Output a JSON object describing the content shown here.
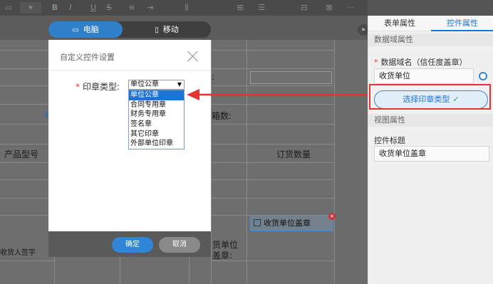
{
  "device_tabs": [
    {
      "label": "电脑",
      "icon": "monitor-icon",
      "active": true
    },
    {
      "label": "移动",
      "icon": "mobile-icon",
      "active": false
    }
  ],
  "form_background": {
    "count_label": "箱数:",
    "col_product_model": "产品型号",
    "col_order_qty": "订货数量",
    "signature_label": "收货人签字",
    "receiver_seal_label": "货单位\n盖章:",
    "seal_field": "收货单位盖章"
  },
  "modal": {
    "title": "自定义控件设置",
    "field_label": "印章类型:",
    "required_mark": "*",
    "selected_value": "单位公章",
    "options": [
      "单位公章",
      "合同专用章",
      "财务专用章",
      "签名章",
      "其它印章",
      "外部单位印章"
    ],
    "ok_label": "确定",
    "cancel_label": "取消"
  },
  "panel": {
    "tabs": [
      {
        "label": "表单属性",
        "active": false
      },
      {
        "label": "控件属性",
        "active": true
      }
    ],
    "section_data": "数据域属性",
    "data_field_label": "数据域名（信任度盖章）",
    "required_mark": "*",
    "data_field_value": "收货单位",
    "seal_type_button": "选择印章类型",
    "section_view": "视图属性",
    "control_title_label": "控件标题",
    "control_title_value": "收货单位盖章"
  },
  "colors": {
    "accent": "#1e73d6",
    "highlight_red": "#e53232"
  }
}
